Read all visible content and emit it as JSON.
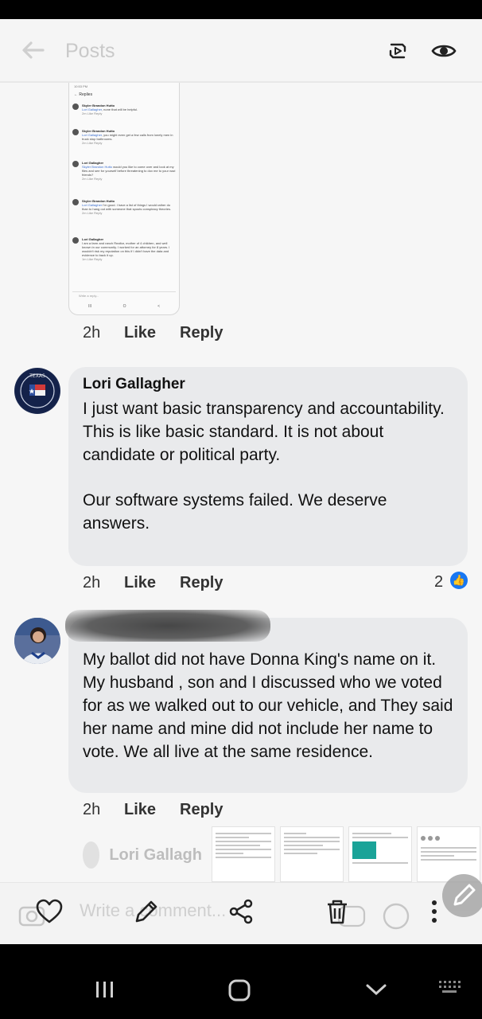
{
  "header": {
    "title": "Posts",
    "icons": [
      "back-arrow-icon",
      "repost-icon",
      "eye-icon"
    ]
  },
  "embedded_screenshot": {
    "status": "10:53 PM",
    "title": "Replies",
    "comments": [
      {
        "name": "Skyler Brandon Hutto",
        "mention": "Lori Gallagher",
        "text": ", none that will be helpful.",
        "meta": "2m   Like   Reply"
      },
      {
        "name": "Skyler Brandon Hutto",
        "mention": "Lori Gallagher",
        "text": ", you might even get a few calls from lonely men in truck stop bathrooms.",
        "meta": "2m   Like   Reply"
      },
      {
        "name": "Lori Gallagher",
        "mention": "Skyler Brandon Hutto",
        "text": " would you like to come over and look at my files and see for yourself before threatening to dox me to your nazi friends?",
        "meta": "2m   Like   Reply"
      },
      {
        "name": "Skyler Brandon Hutto",
        "mention": "Lori Gallagher",
        "text": " I'm good. I have a list of things I would rather do than to hang out with someone that spouts conspiracy theories.",
        "meta": "2m   Like   Reply"
      },
      {
        "name": "Lori Gallagher",
        "mention": "",
        "text": "I am a farm and ranch Realtor, mother of 4 children, and well known in our community. I worked for an attorney for 8 years. I wouldn't risk my reputation on this if I didn't have the data and evidence to back it up.",
        "meta": "1m   Like   Reply"
      }
    ],
    "write_placeholder": "Write a reply...",
    "nav": [
      "III",
      "O",
      "<"
    ]
  },
  "thread_actions": [
    {
      "time": "2h",
      "like": "Like",
      "reply": "Reply"
    },
    {
      "time": "2h",
      "like": "Like",
      "reply": "Reply"
    },
    {
      "time": "2h",
      "like": "Like",
      "reply": "Reply"
    }
  ],
  "comments": [
    {
      "name": "Lori Gallagher",
      "text_p1": "I just want basic transparency and accountability. This is like basic standard. It is not about candidate or political party.",
      "text_p2": "Our software systems failed. We deserve answers.",
      "reaction_count": "2",
      "avatar_text": "TEXAS"
    },
    {
      "name": "",
      "text": "My ballot did not have Donna King's name on it. My husband , son and I discussed who we voted for as we walked out to our vehicle, and They said her name and mine did not include her name to vote. We all live at the same residence."
    }
  ],
  "reply_preview": {
    "name": "Lori Gallagh"
  },
  "bottom_bar": {
    "placeholder": "Write a comment...",
    "icons": [
      "camera-icon",
      "heart-icon",
      "pencil-icon",
      "share-icon",
      "trash-icon",
      "gif-icon",
      "sticker-icon",
      "more-icon"
    ]
  },
  "colors": {
    "like_blue": "#1877f2",
    "bubble": "#e9eaec",
    "link": "#3b6fd0"
  }
}
